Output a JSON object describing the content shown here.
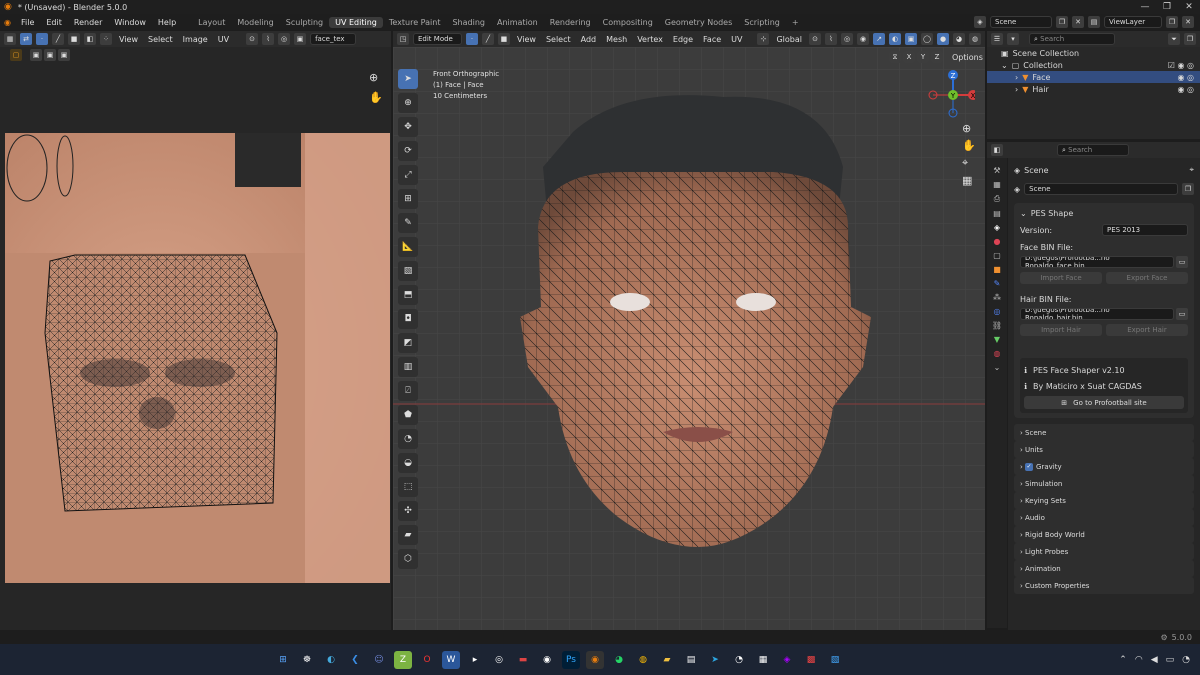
{
  "window": {
    "title": "* (Unsaved) - Blender 5.0.0",
    "controls": [
      "—",
      "❐",
      "✕"
    ]
  },
  "menu": {
    "items": [
      "File",
      "Edit",
      "Render",
      "Window",
      "Help"
    ],
    "workspaces": [
      "Layout",
      "Modeling",
      "Sculpting",
      "UV Editing",
      "Texture Paint",
      "Shading",
      "Animation",
      "Rendering",
      "Compositing",
      "Geometry Nodes",
      "Scripting"
    ],
    "active_workspace": "UV Editing",
    "add": "+",
    "scene": "Scene",
    "view_layer": "ViewLayer"
  },
  "uv_editor": {
    "menus": [
      "View",
      "Select",
      "Image",
      "UV"
    ],
    "image_name": "face_tex"
  },
  "viewport": {
    "mode": "Edit Mode",
    "menus": [
      "View",
      "Select",
      "Add",
      "Mesh",
      "Vertex",
      "Edge",
      "Face",
      "UV"
    ],
    "orientation": "Global",
    "axes": [
      "X",
      "Y",
      "Z"
    ],
    "options": "Options",
    "overlay": {
      "line1": "Front Orthographic",
      "line2": "(1) Face | Face",
      "line3": "10 Centimeters"
    },
    "gizmo": {
      "z": "Z",
      "y": "Y",
      "x": "X"
    }
  },
  "outliner": {
    "search": "Search",
    "root": "Scene Collection",
    "collection": "Collection",
    "items": [
      {
        "name": "Face",
        "selected": true
      },
      {
        "name": "Hair",
        "selected": false
      }
    ]
  },
  "properties": {
    "search": "Search",
    "context": "Scene",
    "scene_field": "Scene",
    "pes": {
      "header": "PES Shape",
      "version_label": "Version:",
      "version_value": "PES 2013",
      "face_label": "Face BIN File:",
      "face_path": "D:\\Juegos\\Profootba...no Ronaldo_face.bin",
      "import_face": "Import Face",
      "export_face": "Export Face",
      "hair_label": "Hair BIN File:",
      "hair_path": "D:\\Juegos\\Profootba...no Ronaldo_hair.bin",
      "import_hair": "Import Hair",
      "export_hair": "Export Hair",
      "info1": "PES Face Shaper v2.10",
      "info2": "By Maticiro x Suat CAGDAS",
      "site_btn": "Go to Profootball site"
    },
    "panels": [
      "Scene",
      "Units",
      "Gravity",
      "Simulation",
      "Keying Sets",
      "Audio",
      "Rigid Body World",
      "Light Probes",
      "Animation",
      "Custom Properties"
    ]
  },
  "statusbar": {
    "version": "5.0.0"
  },
  "colors": {
    "accent": "#4772b3",
    "bg": "#1d1d1d",
    "panel": "#2b2b2b"
  }
}
